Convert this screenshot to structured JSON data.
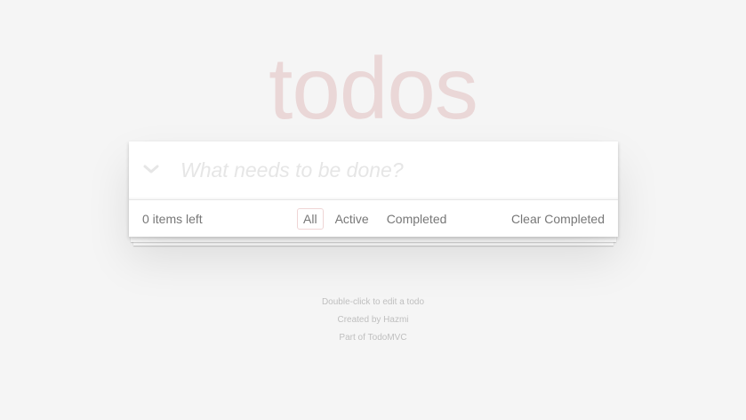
{
  "header": {
    "title": "todos",
    "new_todo_placeholder": "What needs to be done?",
    "new_todo_value": ""
  },
  "footer": {
    "count_text": "0 items left",
    "filters": [
      {
        "label": "All",
        "selected": true
      },
      {
        "label": "Active",
        "selected": false
      },
      {
        "label": "Completed",
        "selected": false
      }
    ],
    "clear_completed_label": "Clear Completed"
  },
  "info": {
    "line1": "Double-click to edit a todo",
    "line2_prefix": "Created by ",
    "line2_author": "Hazmi",
    "line3_prefix": "Part of ",
    "line3_link": "TodoMVC"
  },
  "colors": {
    "title": "#efd5d5",
    "background": "#f5f5f5",
    "selected_filter_border": "#efd5d5"
  },
  "icons": {
    "toggle_all": "chevron-down-icon"
  }
}
